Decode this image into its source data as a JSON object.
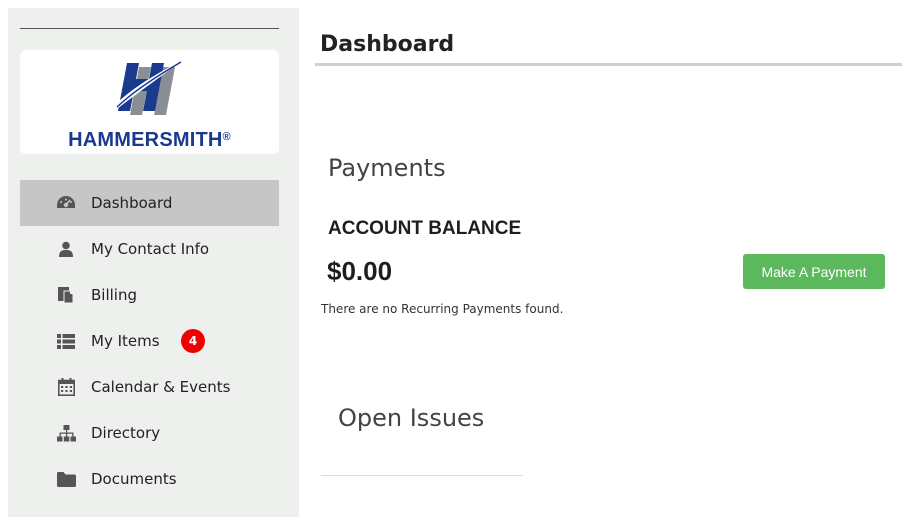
{
  "sidebar": {
    "logo": {
      "name": "HAMMERSMITH",
      "registered_mark": "®",
      "colors": {
        "navy": "#1a3a8e",
        "gray": "#8a8f96"
      }
    },
    "items": [
      {
        "label": "Dashboard",
        "icon": "dashboard-gauge-icon",
        "active": true
      },
      {
        "label": "My Contact Info",
        "icon": "user-icon"
      },
      {
        "label": "Billing",
        "icon": "billing-files-icon"
      },
      {
        "label": "My Items",
        "icon": "list-icon",
        "badge": "4"
      },
      {
        "label": "Calendar & Events",
        "icon": "calendar-icon"
      },
      {
        "label": "Directory",
        "icon": "org-chart-icon"
      },
      {
        "label": "Documents",
        "icon": "folder-icon"
      }
    ]
  },
  "main": {
    "title": "Dashboard",
    "payments": {
      "heading": "Payments",
      "balance_label": "ACCOUNT BALANCE",
      "balance_value": "$0.00",
      "pay_button": "Make A Payment",
      "no_recurring": "There are no Recurring Payments found."
    },
    "open_issues": {
      "heading": "Open Issues"
    }
  },
  "colors": {
    "sidebar_bg": "#eef0ee",
    "active_item_bg": "#c6c6c6",
    "badge": "#f00000",
    "button": "#5cb85c"
  }
}
